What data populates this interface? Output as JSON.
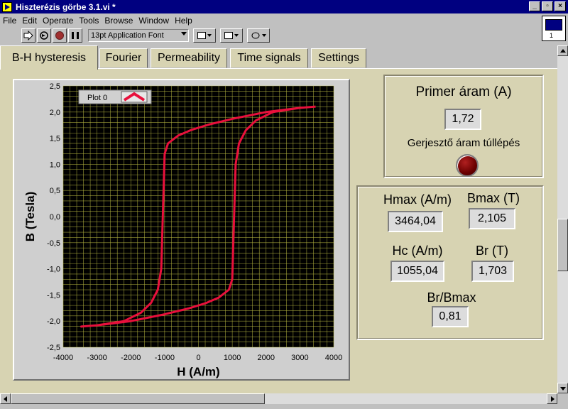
{
  "window": {
    "title": "Hiszterézis görbe 3.1.vi *",
    "buttons": [
      "_",
      "▫",
      "×"
    ]
  },
  "menu": [
    {
      "label": "File"
    },
    {
      "label": "Edit"
    },
    {
      "label": "Operate"
    },
    {
      "label": "Tools"
    },
    {
      "label": "Browse"
    },
    {
      "label": "Window"
    },
    {
      "label": "Help"
    }
  ],
  "toolbar": {
    "font_select": "13pt Application Font",
    "icons": [
      "run-arrow-icon",
      "run-continuously-icon",
      "abort-icon",
      "pause-icon",
      "align-objects-icon",
      "distribute-objects-icon",
      "reorder-icon"
    ]
  },
  "vi_icon": {
    "number": "1"
  },
  "tabs": [
    {
      "label": "B-H hysteresis",
      "active": true
    },
    {
      "label": "Fourier",
      "active": false
    },
    {
      "label": "Permeability",
      "active": false
    },
    {
      "label": "Time signals",
      "active": false
    },
    {
      "label": "Settings",
      "active": false
    }
  ],
  "graph": {
    "legend": "Plot 0",
    "colors": {
      "plot_bg": "#000000",
      "grid": "#b4b440",
      "trace": "#e8103c",
      "frame": "#cfcfcf"
    }
  },
  "chart_data": {
    "type": "line",
    "xlabel": "H (A/m)",
    "ylabel": "B (Tesla)",
    "xlim": [
      -4000,
      4000
    ],
    "ylim": [
      -2.5,
      2.5
    ],
    "x_ticks": [
      -4000,
      -3000,
      -2000,
      -1000,
      0,
      1000,
      2000,
      3000,
      4000
    ],
    "y_ticks": [
      -2.5,
      -2.0,
      -1.5,
      -1.0,
      -0.5,
      0.0,
      0.5,
      1.0,
      1.5,
      2.0,
      2.5
    ],
    "y_tick_labels": [
      "-2,5",
      "-2,0",
      "-1,5",
      "-1,0",
      "-0,5",
      "0,0",
      "0,5",
      "1,0",
      "1,5",
      "2,0",
      "2,5"
    ],
    "grid": true,
    "legend_position": "top-left",
    "series": [
      {
        "name": "Plot 0",
        "x": [
          3464,
          3000,
          2000,
          1000,
          300,
          -200,
          -600,
          -900,
          -1000,
          -1055,
          -1100,
          -1200,
          -1400,
          -1700,
          -2200,
          -3000,
          -3464,
          -3000,
          -2000,
          -1000,
          -300,
          200,
          600,
          900,
          1000,
          1055,
          1100,
          1200,
          1400,
          1700,
          2200,
          3000,
          3464
        ],
        "y": [
          2.105,
          2.08,
          2.0,
          1.87,
          1.76,
          1.66,
          1.55,
          1.4,
          1.2,
          0.0,
          -1.0,
          -1.4,
          -1.65,
          -1.84,
          -2.0,
          -2.08,
          -2.105,
          -2.08,
          -2.0,
          -1.87,
          -1.76,
          -1.66,
          -1.55,
          -1.4,
          -1.2,
          0.0,
          1.0,
          1.4,
          1.65,
          1.84,
          2.0,
          2.08,
          2.105
        ]
      }
    ]
  },
  "primer": {
    "label": "Primer áram (A)",
    "value": "1,72",
    "led_label": "Gerjesztő áram túllépés"
  },
  "results": {
    "hmax_label": "Hmax (A/m)",
    "hmax_value": "3464,04",
    "bmax_label": "Bmax (T)",
    "bmax_value": "2,105",
    "hc_label": "Hc (A/m)",
    "hc_value": "1055,04",
    "br_label": "Br (T)",
    "br_value": "1,703",
    "ratio_label": "Br/Bmax",
    "ratio_value": "0,81"
  }
}
